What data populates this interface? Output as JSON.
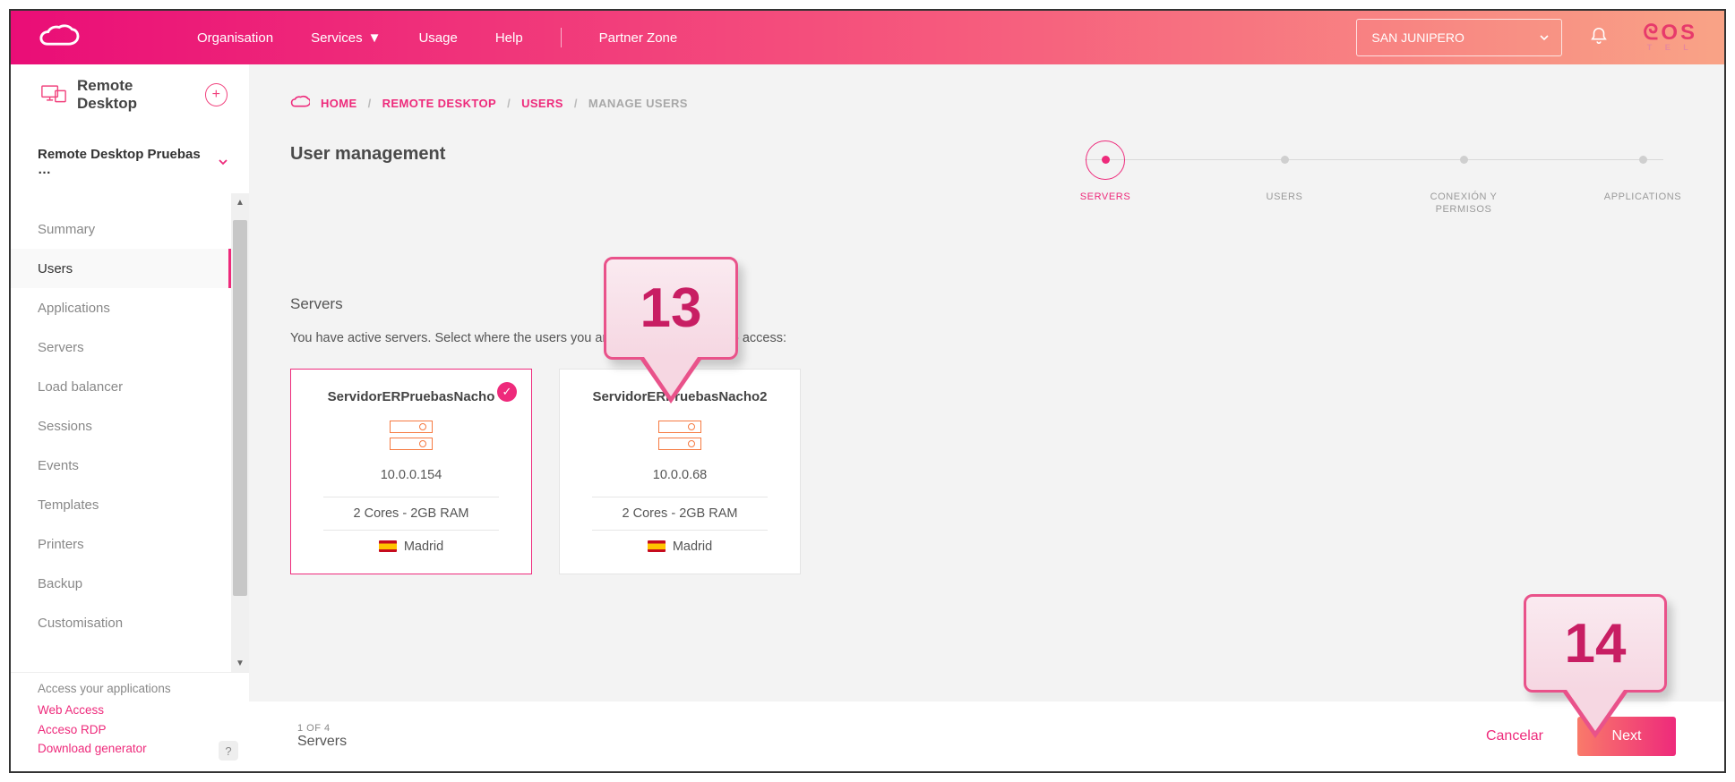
{
  "header": {
    "nav": {
      "organisation": "Organisation",
      "services": "Services",
      "usage": "Usage",
      "help": "Help",
      "partner_zone": "Partner Zone"
    },
    "org_selected": "SAN JUNIPERO"
  },
  "sidebar": {
    "title": "Remote Desktop",
    "project_selected": "Remote Desktop Pruebas …",
    "items": [
      {
        "label": "Summary"
      },
      {
        "label": "Users"
      },
      {
        "label": "Applications"
      },
      {
        "label": "Servers"
      },
      {
        "label": "Load balancer"
      },
      {
        "label": "Sessions"
      },
      {
        "label": "Events"
      },
      {
        "label": "Templates"
      },
      {
        "label": "Printers"
      },
      {
        "label": "Backup"
      },
      {
        "label": "Customisation"
      }
    ],
    "active_index": 1,
    "foot": {
      "header": "Access your applications",
      "links": {
        "web": "Web Access",
        "rdp": "Acceso RDP",
        "gen": "Download generator"
      }
    }
  },
  "breadcrumb": {
    "home": "HOME",
    "l1": "REMOTE DESKTOP",
    "l2": "USERS",
    "l3": "MANAGE USERS"
  },
  "page": {
    "title": "User management",
    "section_title": "Servers",
    "hint": "You have active servers. Select where the users you are adding will be able to access:"
  },
  "stepper": {
    "steps": [
      {
        "label": "SERVERS"
      },
      {
        "label": "USERS"
      },
      {
        "label": "CONEXIÓN Y PERMISOS"
      },
      {
        "label": "APPLICATIONS"
      }
    ]
  },
  "servers": [
    {
      "name": "ServidorERPruebasNacho",
      "ip": "10.0.0.154",
      "spec": "2 Cores - 2GB RAM",
      "location": "Madrid",
      "selected": true
    },
    {
      "name": "ServidorERPruebasNacho2",
      "ip": "10.0.0.68",
      "spec": "2 Cores - 2GB RAM",
      "location": "Madrid",
      "selected": false
    }
  ],
  "footer": {
    "progress": "1 OF 4",
    "step_name": "Servers",
    "cancel": "Cancelar",
    "next": "Next"
  },
  "callouts": {
    "c13": "13",
    "c14": "14"
  },
  "colors": {
    "accent": "#ee2a7b",
    "grad_a": "#ea0d77",
    "grad_b": "#f9a386"
  }
}
